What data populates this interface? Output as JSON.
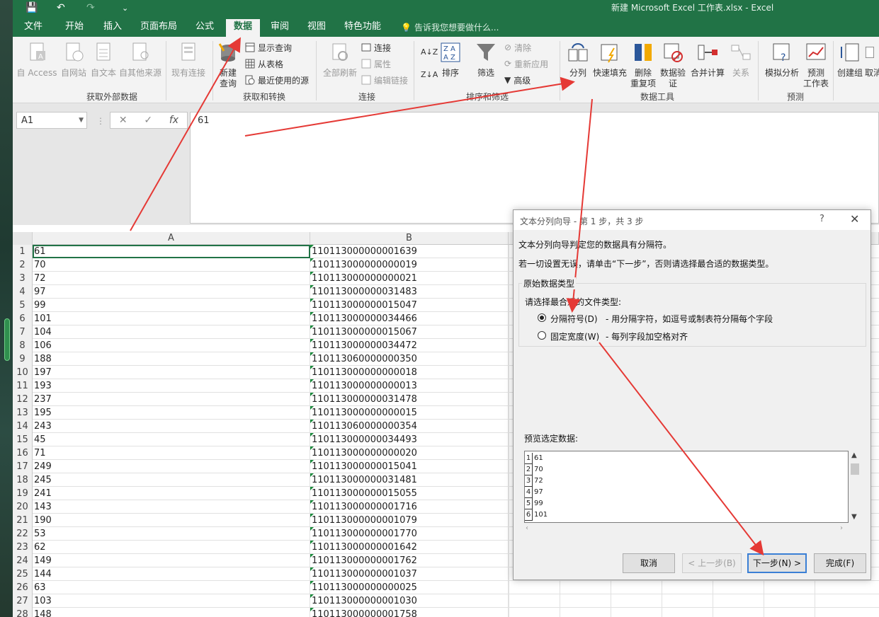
{
  "window": {
    "title": "新建 Microsoft Excel 工作表.xlsx - Excel"
  },
  "quick_access": {
    "save": "💾",
    "undo": "↶",
    "redo": "↷",
    "customize": "⌄"
  },
  "tabs": [
    "文件",
    "开始",
    "插入",
    "页面布局",
    "公式",
    "数据",
    "审阅",
    "视图",
    "特色功能"
  ],
  "active_tab": "数据",
  "tell_me": "告诉我您想要做什么...",
  "ribbon": {
    "get_external": {
      "label": "获取外部数据",
      "access": "自 Access",
      "web": "自网站",
      "text": "自文本",
      "other": "自其他来源",
      "existing": "现有连接"
    },
    "get_transform": {
      "label": "获取和转换",
      "new_query": "新建\n查询",
      "new_query_1": "新建",
      "new_query_2": "查询",
      "show_queries": "显示查询",
      "from_table": "从表格",
      "recent_sources": "最近使用的源"
    },
    "connections": {
      "label": "连接",
      "refresh_all": "全部刷新",
      "connections": "连接",
      "properties": "属性",
      "edit_links": "编辑链接"
    },
    "sort_filter": {
      "label": "排序和筛选",
      "sort": "排序",
      "filter": "筛选",
      "clear": "清除",
      "reapply": "重新应用",
      "advanced": "高级"
    },
    "data_tools": {
      "label": "数据工具",
      "text_to_columns": "分列",
      "flash_fill": "快速填充",
      "remove_dup_1": "删除",
      "remove_dup_2": "重复项",
      "validation_1": "数据验",
      "validation_2": "证",
      "consolidate": "合并计算",
      "relationships": "关系"
    },
    "forecast": {
      "label": "预测",
      "what_if": "模拟分析",
      "forecast_1": "预测",
      "forecast_2": "工作表"
    },
    "outline": {
      "group": "创建组",
      "ungroup": "取消"
    }
  },
  "formula_bar": {
    "name_box": "A1",
    "cancel": "✕",
    "enter": "✓",
    "fx": "fx",
    "value": "61"
  },
  "grid": {
    "columns": [
      "A",
      "B"
    ],
    "rows": [
      {
        "n": "1",
        "a": "61",
        "b": "110113000000001639"
      },
      {
        "n": "2",
        "a": "70",
        "b": "110113000000000019"
      },
      {
        "n": "3",
        "a": "72",
        "b": "110113000000000021"
      },
      {
        "n": "4",
        "a": "97",
        "b": "110113000000031483"
      },
      {
        "n": "5",
        "a": "99",
        "b": "110113000000015047"
      },
      {
        "n": "6",
        "a": "101",
        "b": "110113000000034466"
      },
      {
        "n": "7",
        "a": "104",
        "b": "110113000000015067"
      },
      {
        "n": "8",
        "a": "106",
        "b": "110113000000034472"
      },
      {
        "n": "9",
        "a": "188",
        "b": "110113060000000350"
      },
      {
        "n": "10",
        "a": "197",
        "b": "110113000000000018"
      },
      {
        "n": "11",
        "a": "193",
        "b": "110113000000000013"
      },
      {
        "n": "12",
        "a": "237",
        "b": "110113000000031478"
      },
      {
        "n": "13",
        "a": "195",
        "b": "110113000000000015"
      },
      {
        "n": "14",
        "a": "243",
        "b": "110113060000000354"
      },
      {
        "n": "15",
        "a": "45",
        "b": "110113000000034493"
      },
      {
        "n": "16",
        "a": "71",
        "b": "110113000000000020"
      },
      {
        "n": "17",
        "a": "249",
        "b": "110113000000015041"
      },
      {
        "n": "18",
        "a": "245",
        "b": "110113000000031481"
      },
      {
        "n": "19",
        "a": "241",
        "b": "110113000000015055"
      },
      {
        "n": "20",
        "a": "143",
        "b": "110113000000001716"
      },
      {
        "n": "21",
        "a": "190",
        "b": "110113000000001079"
      },
      {
        "n": "22",
        "a": "53",
        "b": "110113000000001770"
      },
      {
        "n": "23",
        "a": "62",
        "b": "110113000000001642"
      },
      {
        "n": "24",
        "a": "149",
        "b": "110113000000001762"
      },
      {
        "n": "25",
        "a": "144",
        "b": "110113000000001037"
      },
      {
        "n": "26",
        "a": "63",
        "b": "110113000000000025"
      },
      {
        "n": "27",
        "a": "103",
        "b": "110113000000001030"
      },
      {
        "n": "28",
        "a": "148",
        "b": "110113000000001758"
      }
    ]
  },
  "dialog": {
    "title": "文本分列向导 - 第 1 步，共 3 步",
    "help": "?",
    "close": "✕",
    "line1": "文本分列向导判定您的数据具有分隔符。",
    "line2": "若一切设置无误，请单击“下一步”，否则请选择最合适的数据类型。",
    "section": "原始数据类型",
    "prompt": "请选择最合适的文件类型:",
    "opt_delimited": "分隔符号(D)",
    "opt_delimited_desc": "- 用分隔字符，如逗号或制表符分隔每个字段",
    "opt_fixed": "固定宽度(W)",
    "opt_fixed_desc": "- 每列字段加空格对齐",
    "preview_label": "预览选定数据:",
    "preview": [
      {
        "n": "1",
        "v": "61"
      },
      {
        "n": "2",
        "v": "70"
      },
      {
        "n": "3",
        "v": "72"
      },
      {
        "n": "4",
        "v": "97"
      },
      {
        "n": "5",
        "v": "99"
      },
      {
        "n": "6",
        "v": "101"
      }
    ],
    "btn_cancel": "取消",
    "btn_back": "< 上一步(B)",
    "btn_next": "下一步(N) >",
    "btn_finish": "完成(F)"
  },
  "colors": {
    "excel_green": "#217346",
    "annotation_red": "#e53935"
  }
}
